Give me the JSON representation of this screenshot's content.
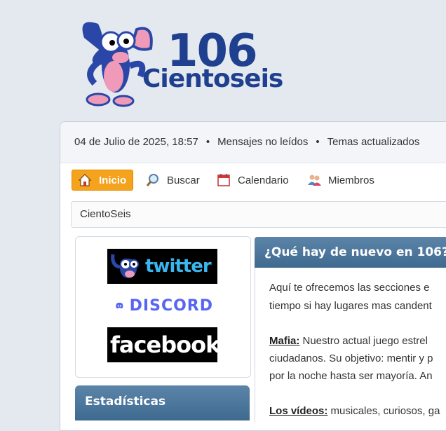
{
  "logo": {
    "number": "106",
    "name": "Cientoseis"
  },
  "topbar": {
    "date": "04 de Julio de 2025, 18:57",
    "separator": "•",
    "unread": "Mensajes no leídos",
    "updated": "Temas actualizados"
  },
  "nav": {
    "items": [
      {
        "label": "Inicio",
        "icon": "home-icon",
        "active": true
      },
      {
        "label": "Buscar",
        "icon": "search-icon"
      },
      {
        "label": "Calendario",
        "icon": "calendar-icon"
      },
      {
        "label": "Miembros",
        "icon": "members-icon"
      }
    ]
  },
  "breadcrumb": {
    "label": "CientoSeis"
  },
  "social": {
    "twitter": "twitter",
    "discord": "DISCORD",
    "facebook": "facebook"
  },
  "stats": {
    "title": "Estadísticas"
  },
  "news": {
    "title": "¿Qué hay de nuevo en 106?",
    "lines": [
      "Aquí te ofrecemos las secciones e",
      "tiempo si hay lugares mas candent"
    ],
    "mafia_label": "Mafia:",
    "mafia_lines": [
      " Nuestro actual juego estrel",
      "ciudadanos. Su objetivo: mentir y p",
      "por la noche hasta ser mayoría. An"
    ],
    "videos_label": "Los vídeos:",
    "videos_rest": " musicales, curiosos, ga"
  },
  "colors": {
    "accent": "#f5a21d",
    "header": "#4a7399",
    "brand": "#1f3f8f"
  }
}
